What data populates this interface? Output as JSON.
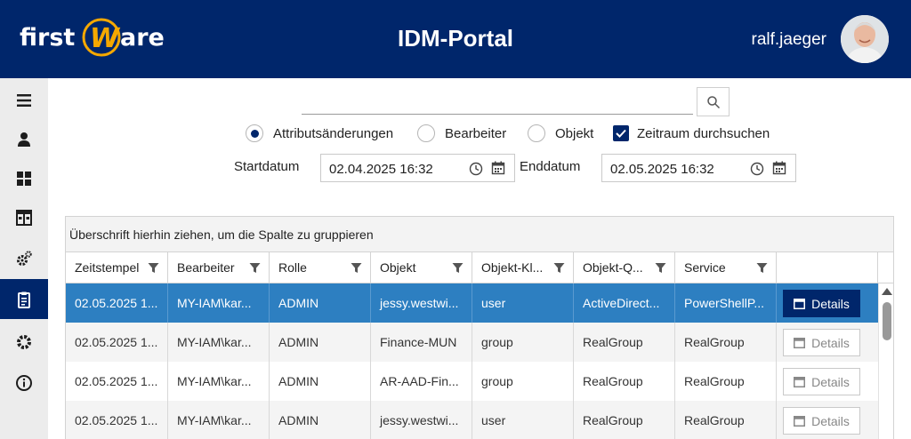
{
  "header": {
    "logo_text": "firstWare",
    "title": "IDM-Portal",
    "username": "ralf.jaeger",
    "background": "#00266b"
  },
  "sidebar": {
    "items": [
      {
        "icon": "menu-icon",
        "active": false
      },
      {
        "icon": "user-icon",
        "active": false
      },
      {
        "icon": "dashboard-icon",
        "active": false
      },
      {
        "icon": "panels-icon",
        "active": false
      },
      {
        "icon": "gears-icon",
        "active": false
      },
      {
        "icon": "clipboard-icon",
        "active": true
      },
      {
        "icon": "gear-icon",
        "active": false
      },
      {
        "icon": "info-icon",
        "active": false
      }
    ]
  },
  "search": {
    "value": "",
    "placeholder": ""
  },
  "options": {
    "attributsaenderungen": "Attributsänderungen",
    "bearbeiter": "Bearbeiter",
    "objekt": "Objekt",
    "zeitraum": "Zeitraum durchsuchen",
    "selected_radio": "attributsaenderungen",
    "zeitraum_checked": true
  },
  "dates": {
    "start_label": "Startdatum",
    "start_value": "02.04.2025 16:32",
    "end_label": "Enddatum",
    "end_value": "02.05.2025 16:32"
  },
  "grid": {
    "group_hint": "Überschrift hierhin ziehen, um die Spalte zu gruppieren",
    "columns": [
      "Zeitstempel",
      "Bearbeiter",
      "Rolle",
      "Objekt",
      "Objekt-Kl...",
      "Objekt-Q...",
      "Service"
    ],
    "details_label": "Details",
    "rows": [
      {
        "zeitstempel": "02.05.2025 1...",
        "bearbeiter": "MY-IAM\\kar...",
        "rolle": "ADMIN",
        "objekt": "jessy.westwi...",
        "klasse": "user",
        "quelle": "ActiveDirect...",
        "service": "PowerShellP...",
        "selected": true
      },
      {
        "zeitstempel": "02.05.2025 1...",
        "bearbeiter": "MY-IAM\\kar...",
        "rolle": "ADMIN",
        "objekt": "Finance-MUN",
        "klasse": "group",
        "quelle": "RealGroup",
        "service": "RealGroup",
        "selected": false
      },
      {
        "zeitstempel": "02.05.2025 1...",
        "bearbeiter": "MY-IAM\\kar...",
        "rolle": "ADMIN",
        "objekt": "AR-AAD-Fin...",
        "klasse": "group",
        "quelle": "RealGroup",
        "service": "RealGroup",
        "selected": false
      },
      {
        "zeitstempel": "02.05.2025 1...",
        "bearbeiter": "MY-IAM\\kar...",
        "rolle": "ADMIN",
        "objekt": "jessy.westwi...",
        "klasse": "user",
        "quelle": "RealGroup",
        "service": "RealGroup",
        "selected": false
      }
    ]
  }
}
